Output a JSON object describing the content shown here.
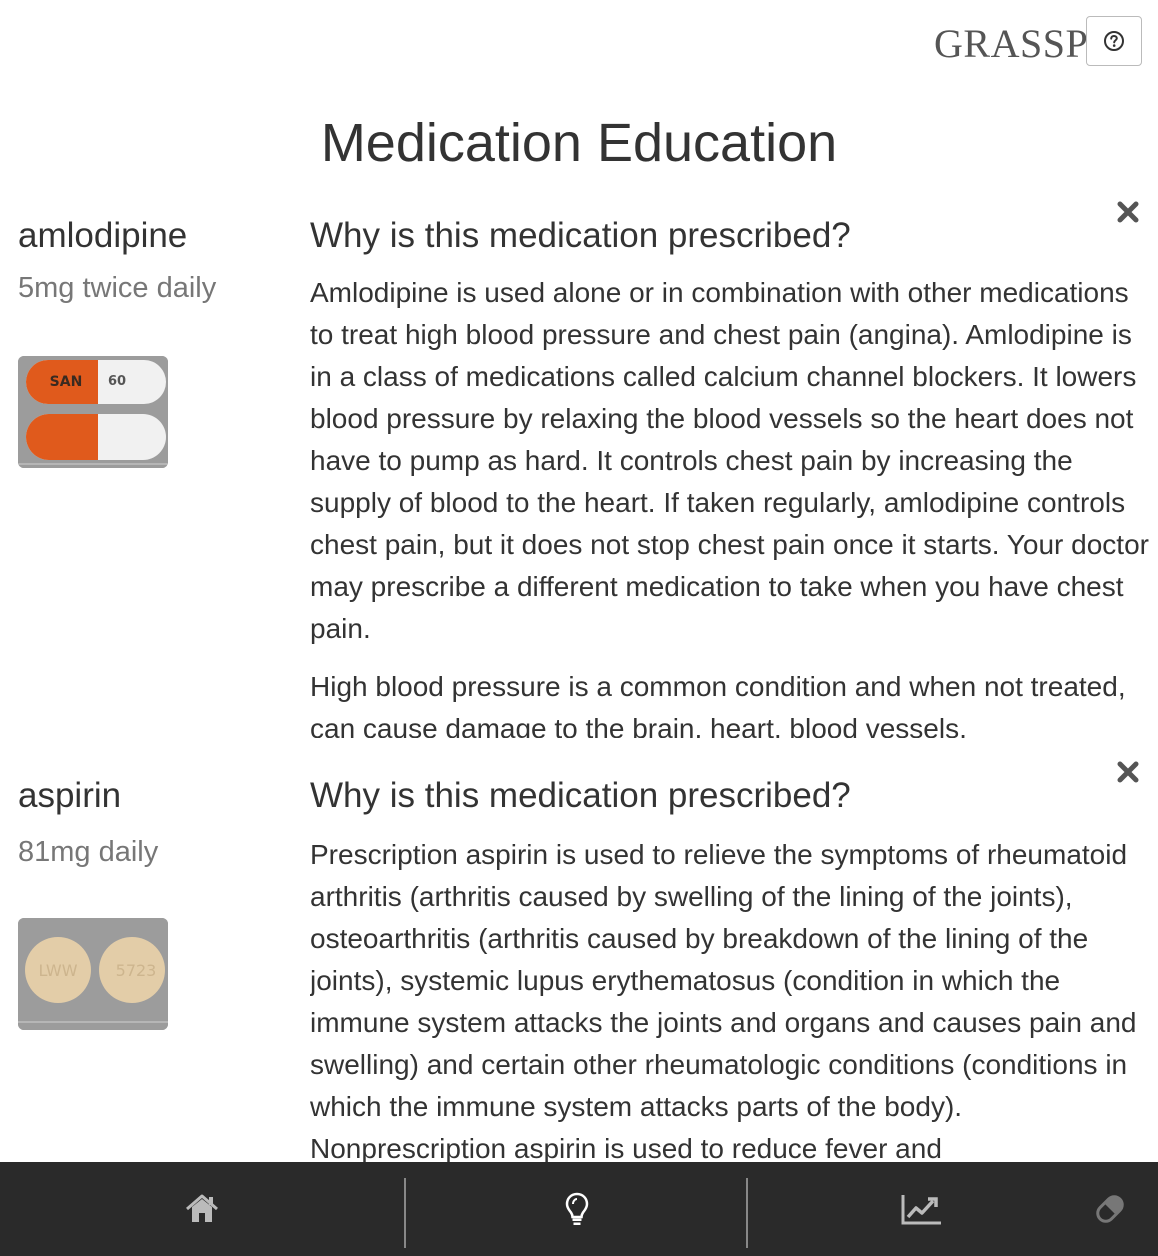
{
  "header": {
    "brand": "GRASSP",
    "help_icon": "question-circle-icon"
  },
  "page": {
    "title": "Medication Education"
  },
  "medications": [
    {
      "name": "amlodipine",
      "dose": "5mg twice daily",
      "pill_image": {
        "imprint_1": "SAN",
        "imprint_2": "60",
        "colors": [
          "#e05a1c",
          "#f2f2f2"
        ]
      },
      "section_title": "Why is this medication prescribed?",
      "paragraphs": [
        "Amlodipine is used alone or in combination with other medications to treat high blood pressure and chest pain (angina). Amlodipine is in a class of medications called calcium channel blockers. It lowers blood pressure by relaxing the blood vessels so the heart does not have to pump as hard. It controls chest pain by increasing the supply of blood to the heart. If taken regularly, amlodipine controls chest pain, but it does not stop chest pain once it starts. Your doctor may prescribe a different medication to take when you have chest pain.",
        "High blood pressure is a common condition and when not treated, can cause damage to the brain, heart, blood vessels,"
      ]
    },
    {
      "name": "aspirin",
      "dose": "81mg daily",
      "pill_image": {
        "imprint_1": "LWW",
        "imprint_2": "5723",
        "colors": [
          "#e3cda8"
        ]
      },
      "section_title": "Why is this medication prescribed?",
      "paragraphs": [
        "Prescription aspirin is used to relieve the symptoms of rheumatoid arthritis (arthritis caused by swelling of the lining of the joints), osteoarthritis (arthritis caused by breakdown of the lining of the joints), systemic lupus erythematosus (condition in which the immune system attacks the joints and organs and causes pain and swelling) and certain other rheumatologic conditions (conditions in which the immune system attacks parts of the body). Nonprescription aspirin is used to reduce fever and"
      ]
    }
  ],
  "nav": {
    "items": [
      "home-icon",
      "lightbulb-icon",
      "line-chart-icon",
      "pill-icon"
    ],
    "background": "#2a2a2a"
  }
}
